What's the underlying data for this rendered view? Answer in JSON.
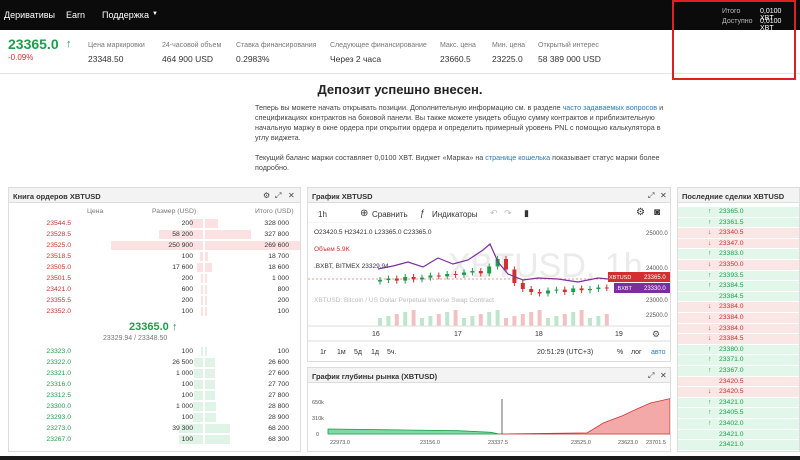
{
  "nav": {
    "derivatives": "Деривативы",
    "earn": "Earn",
    "support": "Поддержка",
    "support_arrow": "▼"
  },
  "wallet": {
    "total_label": "Итого",
    "total_value": "0,0100 XBT",
    "available_label": "Доступно",
    "available_value": "0,0100 XBT"
  },
  "ticker": {
    "price": "23365.0",
    "arrow": "↑",
    "change": "-0.09%",
    "stats": [
      {
        "label": "Цена маркировки",
        "value": "23348.50"
      },
      {
        "label": "24-часовой объем",
        "value": "464 900 USD"
      },
      {
        "label": "Ставка финансирования",
        "value": "0.2983%"
      },
      {
        "label": "Следующее финансирование",
        "value": "Через 2 часа"
      },
      {
        "label": "Макс. цена",
        "value": "23660.5"
      },
      {
        "label": "Мин. цена",
        "value": "23225.0"
      },
      {
        "label": "Открытый интерес",
        "value": "58 389 000 USD"
      }
    ]
  },
  "message": {
    "title": "Депозит успешно внесен.",
    "p1a": "Теперь вы можете начать открывать позиции. Дополнительную информацию см. в разделе ",
    "p1link": "часто задаваемых вопросов",
    "p1b": " и",
    "p1c": "спецификациях контрактов на боковой панели. Вы также можете увидеть общую сумму контрактов и приблизительную",
    "p1d": "начальную маржу в окне ордера при открытии ордера и определить примерный уровень PNL с помощью калькулятора в",
    "p1e": "углу виджета.",
    "p2a": "Текущий баланс маржи составляет 0,0100 XBT. Виджет «Маржа» на ",
    "p2link": "странице кошелька",
    "p2b": " показывает статус маржи более",
    "p2c": "подробно."
  },
  "orderbook": {
    "title": "Книга ордеров XBTUSD",
    "col_price": "Цена",
    "col_size": "Размер (USD)",
    "col_total": "Итого (USD)",
    "asks": [
      [
        "23544.5",
        "200",
        "328 000",
        0.14
      ],
      [
        "23528.5",
        "58 200",
        "327 800",
        0.48
      ],
      [
        "23525.0",
        "250 900",
        "269 600",
        1.0
      ],
      [
        "23518.5",
        "100",
        "18 700",
        0.03
      ],
      [
        "23505.0",
        "17 600",
        "18 600",
        0.07
      ],
      [
        "23501.5",
        "200",
        "1 000",
        0.02
      ],
      [
        "23421.0",
        "600",
        "800",
        0.02
      ],
      [
        "23355.5",
        "200",
        "200",
        0.01
      ],
      [
        "23352.0",
        "100",
        "100",
        0.01
      ]
    ],
    "last_price": "23365.0",
    "last_arrow": "↑",
    "mark_index": "23329.94 / 23348.50",
    "bids": [
      [
        "23323.0",
        "100",
        "100",
        0.01
      ],
      [
        "23322.0",
        "26 500",
        "26 600",
        0.1
      ],
      [
        "23321.0",
        "1 000",
        "27 600",
        0.1
      ],
      [
        "23316.0",
        "100",
        "27 700",
        0.1
      ],
      [
        "23312.5",
        "100",
        "27 800",
        0.1
      ],
      [
        "23300.0",
        "1 000",
        "28 800",
        0.11
      ],
      [
        "23293.0",
        "100",
        "28 900",
        0.11
      ],
      [
        "23273.0",
        "39 300",
        "68 200",
        0.26
      ],
      [
        "23267.0",
        "100",
        "68 300",
        0.26
      ]
    ]
  },
  "chart": {
    "title": "График XBTUSD",
    "interval": "1h",
    "compare": "Сравнить",
    "indicators": "Индикаторы",
    "symbol_watermark": "XBTUSD, 1h",
    "ohlc": "O23420.5 H23421.0 L23365.0 C23365.0",
    "volume": "Объем 5.9K",
    "index_line": ".BXBT, BITMEX 23329.94",
    "description": "XBTUSD: Bitcoin / US Dollar Perpetual Inverse Swap Contract",
    "price_tag": "23365.0",
    "price_tag_symbol": "XBTUSD",
    "index_tag": "23330.0",
    "index_tag_symbol": ".BXBT",
    "x_ticks": [
      "16",
      "17",
      "18",
      "19"
    ],
    "y_ticks": [
      "25000.0",
      "24000.0",
      "23000.0",
      "22500.0"
    ],
    "ranges": [
      "1г",
      "1м",
      "5д",
      "1д",
      "5ч."
    ],
    "clock": "20:51:29 (UTC+3)",
    "pct": "%",
    "log": "лог",
    "auto": "авто"
  },
  "depth": {
    "title": "График глубины рынка (XBTUSD)",
    "y_ticks": [
      "650k",
      "310k",
      "0"
    ],
    "x_ticks": [
      "22973.0",
      "23156.0",
      "23337.5",
      "23525.0",
      "23623.0",
      "23701.5"
    ]
  },
  "chart_data": {
    "type": "area",
    "title": "График глубины рынка (XBTUSD)",
    "series": [
      {
        "name": "bids",
        "x": [
          22973.0,
          23156.0,
          23250.0,
          23320.0,
          23337.5
        ],
        "y": [
          90000,
          70000,
          60000,
          30000,
          0
        ]
      },
      {
        "name": "asks",
        "x": [
          23337.5,
          23525.0,
          23560.0,
          23600.0,
          23623.0,
          23660.0,
          23701.5
        ],
        "y": [
          0,
          20000,
          200000,
          330000,
          420000,
          560000,
          640000
        ]
      }
    ],
    "xlabel": "",
    "ylabel": "",
    "ylim": [
      0,
      650000
    ]
  },
  "trades": {
    "title": "Последние сделки XBTUSD",
    "rows": [
      [
        "↑",
        "23365.0",
        "g"
      ],
      [
        "↑",
        "23361.5",
        "g"
      ],
      [
        "↓",
        "23340.5",
        "r"
      ],
      [
        "↓",
        "23347.0",
        "r"
      ],
      [
        "↑",
        "23383.0",
        "g"
      ],
      [
        "↓",
        "23350.0",
        "r"
      ],
      [
        "↑",
        "23393.5",
        "g"
      ],
      [
        "↑",
        "23384.5",
        "g"
      ],
      [
        "",
        "23384.5",
        "g"
      ],
      [
        "↓",
        "23384.0",
        "r"
      ],
      [
        "↓",
        "23384.0",
        "r"
      ],
      [
        "↓",
        "23384.0",
        "r"
      ],
      [
        "↓",
        "23384.5",
        "r"
      ],
      [
        "↑",
        "23380.0",
        "g"
      ],
      [
        "↑",
        "23371.0",
        "g"
      ],
      [
        "↑",
        "23367.0",
        "g"
      ],
      [
        "",
        "23420.5",
        "r"
      ],
      [
        "↓",
        "23420.5",
        "r"
      ],
      [
        "↑",
        "23421.0",
        "g"
      ],
      [
        "↑",
        "23405.5",
        "g"
      ],
      [
        "↑",
        "23402.0",
        "g"
      ],
      [
        "",
        "23421.0",
        "g"
      ],
      [
        "",
        "23421.0",
        "g"
      ]
    ]
  }
}
